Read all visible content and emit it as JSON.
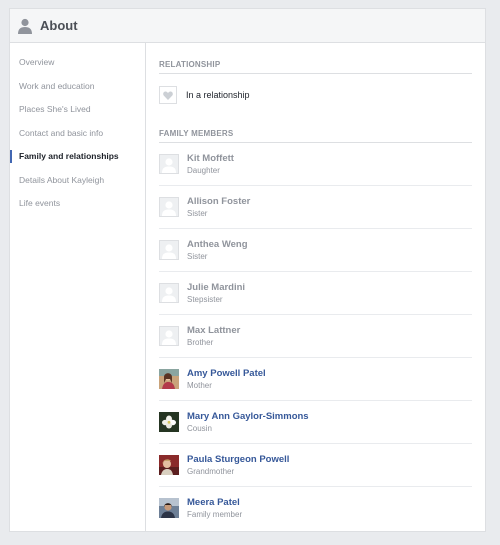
{
  "header": {
    "title": "About"
  },
  "sidebar": {
    "items": [
      {
        "label": "Overview",
        "active": false
      },
      {
        "label": "Work and education",
        "active": false
      },
      {
        "label": "Places She's Lived",
        "active": false
      },
      {
        "label": "Contact and basic info",
        "active": false
      },
      {
        "label": "Family and relationships",
        "active": true
      },
      {
        "label": "Details About Kayleigh",
        "active": false
      },
      {
        "label": "Life events",
        "active": false
      }
    ]
  },
  "relationship": {
    "section_title": "RELATIONSHIP",
    "status": "In a relationship"
  },
  "family": {
    "section_title": "FAMILY MEMBERS",
    "members": [
      {
        "name": "Kit Moffett",
        "relation": "Daughter",
        "photo": "placeholder"
      },
      {
        "name": "Allison Foster",
        "relation": "Sister",
        "photo": "placeholder"
      },
      {
        "name": "Anthea Weng",
        "relation": "Sister",
        "photo": "placeholder"
      },
      {
        "name": "Julie Mardini",
        "relation": "Stepsister",
        "photo": "placeholder"
      },
      {
        "name": "Max Lattner",
        "relation": "Brother",
        "photo": "placeholder"
      },
      {
        "name": "Amy Powell Patel",
        "relation": "Mother",
        "photo": "photo-amy"
      },
      {
        "name": "Mary Ann Gaylor-Simmons",
        "relation": "Cousin",
        "photo": "photo-flower"
      },
      {
        "name": "Paula Sturgeon Powell",
        "relation": "Grandmother",
        "photo": "photo-paula"
      },
      {
        "name": "Meera Patel",
        "relation": "Family member",
        "photo": "photo-meera"
      }
    ]
  },
  "colors": {
    "link": "#365899",
    "muted": "#90949c",
    "accent": "#4267b2",
    "background": "#e9ebee"
  }
}
